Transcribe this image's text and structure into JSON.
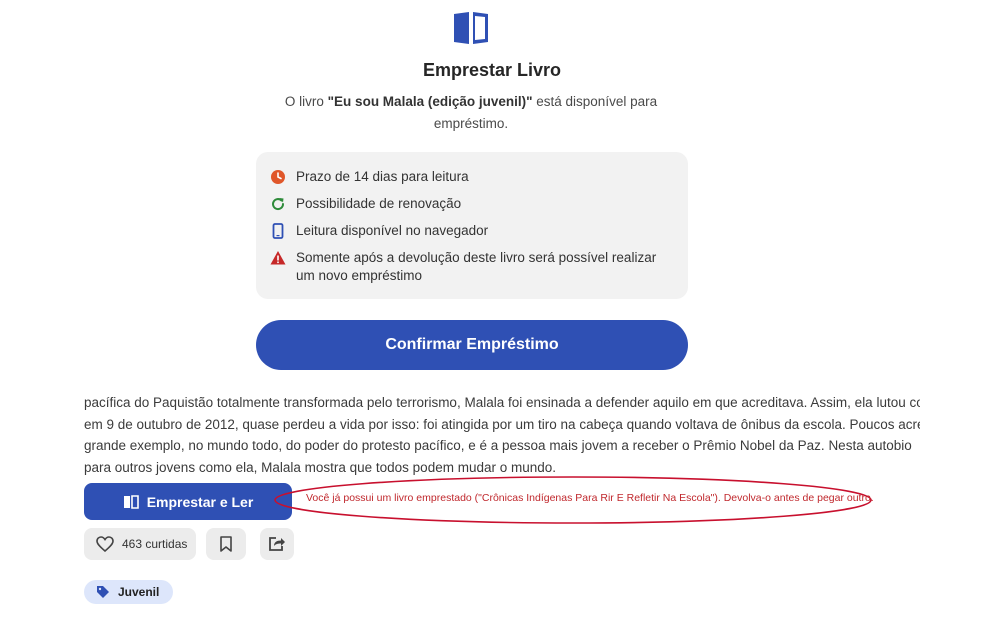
{
  "modal": {
    "title": "Emprestar Livro",
    "desc_prefix": "O livro ",
    "book_title": "\"Eu sou Malala (edição juvenil)\"",
    "desc_suffix": " está disponível para empréstimo.",
    "info": [
      {
        "icon": "clock-icon",
        "text": "Prazo de 14 dias para leitura"
      },
      {
        "icon": "refresh-icon",
        "text": "Possibilidade de renovação"
      },
      {
        "icon": "smartphone-icon",
        "text": "Leitura disponível no navegador"
      },
      {
        "icon": "warning-icon",
        "text": "Somente após a devolução deste livro será possível realizar um novo empréstimo"
      }
    ],
    "confirm_label": "Confirmar Empréstimo"
  },
  "article": {
    "lines": [
      "pacífica do Paquistão totalmente transformada pelo terrorismo, Malala foi ensinada a defender aquilo em que acreditava. Assim, ela lutou co",
      "em 9 de outubro de 2012, quase perdeu a vida por isso: foi atingida por um tiro na cabeça quando voltava de ônibus da escola. Poucos acre",
      "grande exemplo, no mundo todo, do poder do protesto pacífico, e é a pessoa mais jovem a receber o Prêmio Nobel da Paz. Nesta autobio",
      "para outros jovens como ela, Malala mostra que todos podem mudar o mundo."
    ]
  },
  "actions": {
    "borrow_label": "Emprestar e Ler",
    "error_message": "Você já possui um livro emprestado (\"Crônicas Indígenas Para Rir E Refletir Na Escola\"). Devolva-o antes de pegar outro.",
    "likes_label": "463 curtidas"
  },
  "tag": {
    "label": "Juvenil"
  },
  "colors": {
    "primary": "#2f50b4",
    "error": "#c0282d",
    "clock": "#e0572a",
    "refresh": "#2e8b3a",
    "warning": "#c62828"
  }
}
